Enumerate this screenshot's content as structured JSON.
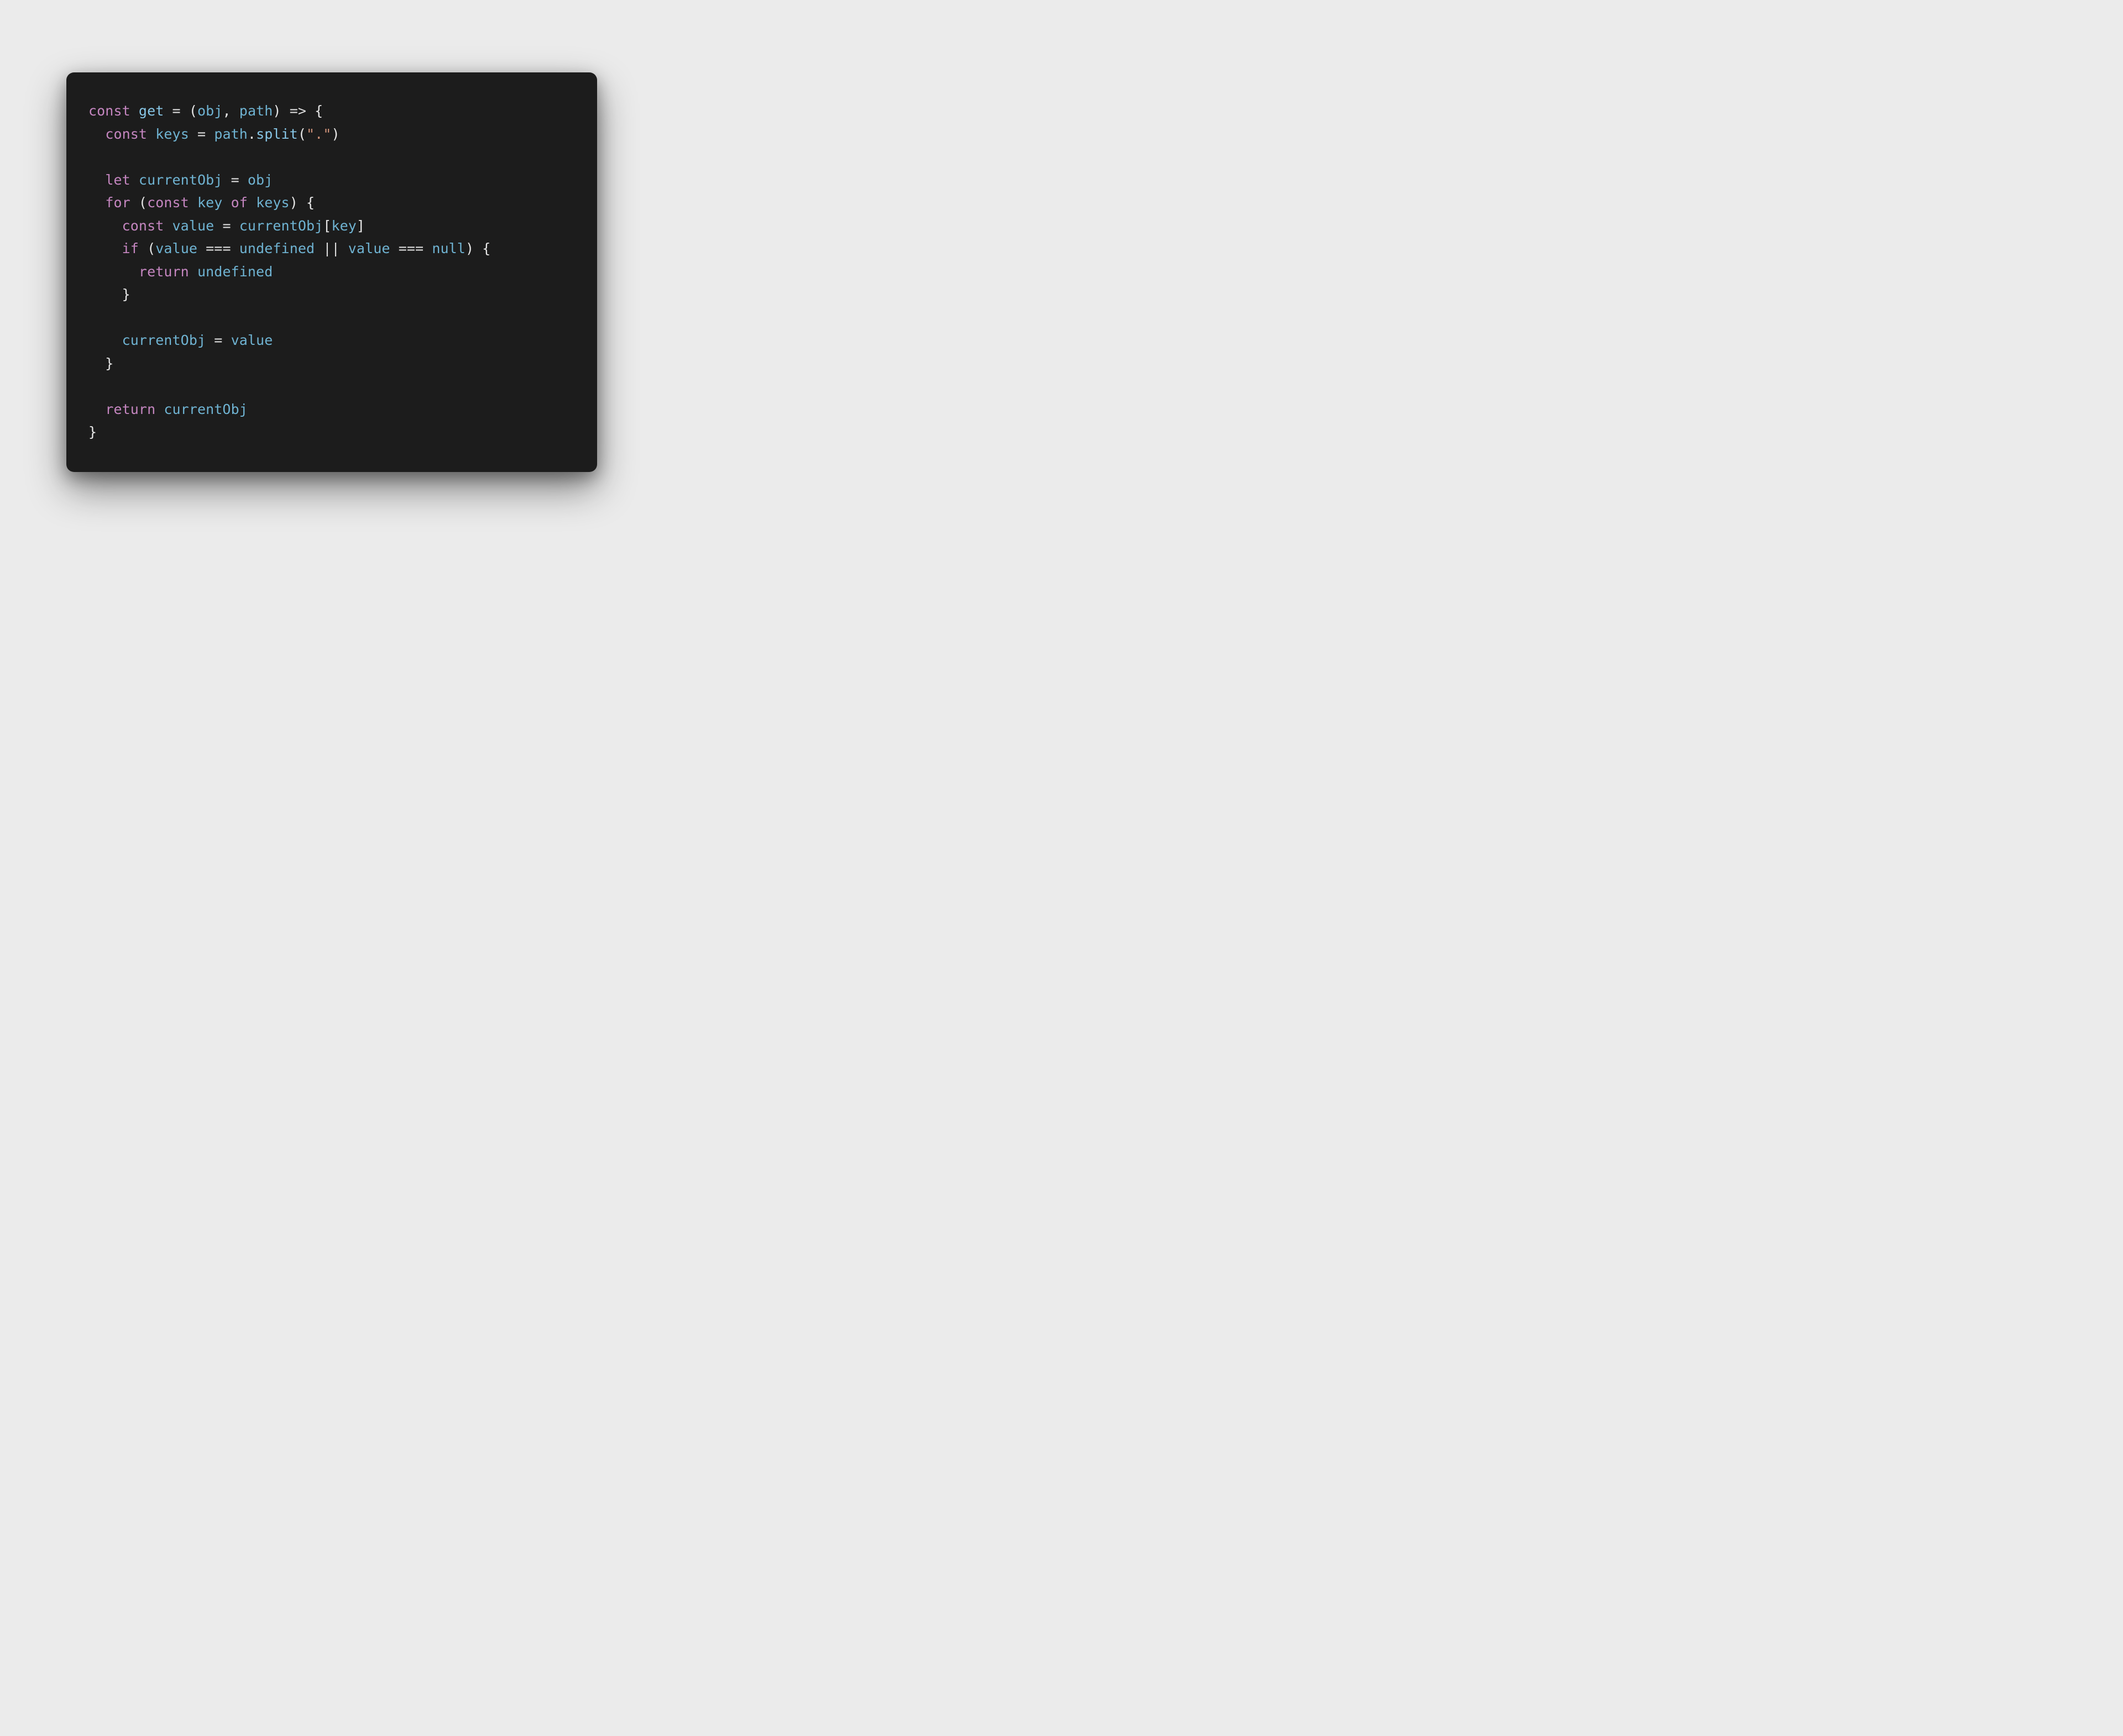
{
  "code": {
    "tokens": [
      [
        {
          "t": "const ",
          "c": "tok-kw"
        },
        {
          "t": "get",
          "c": "tok-fn"
        },
        {
          "t": " ",
          "c": "tok-pun"
        },
        {
          "t": "=",
          "c": "tok-op"
        },
        {
          "t": " (",
          "c": "tok-pun"
        },
        {
          "t": "obj",
          "c": "tok-var"
        },
        {
          "t": ", ",
          "c": "tok-pun"
        },
        {
          "t": "path",
          "c": "tok-var"
        },
        {
          "t": ") ",
          "c": "tok-pun"
        },
        {
          "t": "=>",
          "c": "tok-op"
        },
        {
          "t": " {",
          "c": "tok-pun"
        }
      ],
      [
        {
          "t": "  ",
          "c": "tok-pun"
        },
        {
          "t": "const ",
          "c": "tok-kw"
        },
        {
          "t": "keys",
          "c": "tok-var"
        },
        {
          "t": " ",
          "c": "tok-pun"
        },
        {
          "t": "=",
          "c": "tok-op"
        },
        {
          "t": " ",
          "c": "tok-pun"
        },
        {
          "t": "path",
          "c": "tok-var"
        },
        {
          "t": ".",
          "c": "tok-pun"
        },
        {
          "t": "split",
          "c": "tok-fn"
        },
        {
          "t": "(",
          "c": "tok-pun"
        },
        {
          "t": "\".\"",
          "c": "tok-str"
        },
        {
          "t": ")",
          "c": "tok-pun"
        }
      ],
      [
        {
          "t": " ",
          "c": "tok-pun"
        }
      ],
      [
        {
          "t": "  ",
          "c": "tok-pun"
        },
        {
          "t": "let ",
          "c": "tok-kw"
        },
        {
          "t": "currentObj",
          "c": "tok-var"
        },
        {
          "t": " ",
          "c": "tok-pun"
        },
        {
          "t": "=",
          "c": "tok-op"
        },
        {
          "t": " ",
          "c": "tok-pun"
        },
        {
          "t": "obj",
          "c": "tok-var"
        }
      ],
      [
        {
          "t": "  ",
          "c": "tok-pun"
        },
        {
          "t": "for ",
          "c": "tok-kw"
        },
        {
          "t": "(",
          "c": "tok-pun"
        },
        {
          "t": "const ",
          "c": "tok-kw"
        },
        {
          "t": "key",
          "c": "tok-var"
        },
        {
          "t": " ",
          "c": "tok-pun"
        },
        {
          "t": "of",
          "c": "tok-kw"
        },
        {
          "t": " ",
          "c": "tok-pun"
        },
        {
          "t": "keys",
          "c": "tok-var"
        },
        {
          "t": ") {",
          "c": "tok-pun"
        }
      ],
      [
        {
          "t": "    ",
          "c": "tok-pun"
        },
        {
          "t": "const ",
          "c": "tok-kw"
        },
        {
          "t": "value",
          "c": "tok-var"
        },
        {
          "t": " ",
          "c": "tok-pun"
        },
        {
          "t": "=",
          "c": "tok-op"
        },
        {
          "t": " ",
          "c": "tok-pun"
        },
        {
          "t": "currentObj",
          "c": "tok-var"
        },
        {
          "t": "[",
          "c": "tok-pun"
        },
        {
          "t": "key",
          "c": "tok-var"
        },
        {
          "t": "]",
          "c": "tok-pun"
        }
      ],
      [
        {
          "t": "    ",
          "c": "tok-pun"
        },
        {
          "t": "if ",
          "c": "tok-kw"
        },
        {
          "t": "(",
          "c": "tok-pun"
        },
        {
          "t": "value",
          "c": "tok-var"
        },
        {
          "t": " ",
          "c": "tok-pun"
        },
        {
          "t": "===",
          "c": "tok-op"
        },
        {
          "t": " ",
          "c": "tok-pun"
        },
        {
          "t": "undefined",
          "c": "tok-undf"
        },
        {
          "t": " ",
          "c": "tok-pun"
        },
        {
          "t": "||",
          "c": "tok-op"
        },
        {
          "t": " ",
          "c": "tok-pun"
        },
        {
          "t": "value",
          "c": "tok-var"
        },
        {
          "t": " ",
          "c": "tok-pun"
        },
        {
          "t": "===",
          "c": "tok-op"
        },
        {
          "t": " ",
          "c": "tok-pun"
        },
        {
          "t": "null",
          "c": "tok-undf"
        },
        {
          "t": ") {",
          "c": "tok-pun"
        }
      ],
      [
        {
          "t": "      ",
          "c": "tok-pun"
        },
        {
          "t": "return ",
          "c": "tok-kw"
        },
        {
          "t": "undefined",
          "c": "tok-undf"
        }
      ],
      [
        {
          "t": "    }",
          "c": "tok-pun"
        }
      ],
      [
        {
          "t": " ",
          "c": "tok-pun"
        }
      ],
      [
        {
          "t": "    ",
          "c": "tok-pun"
        },
        {
          "t": "currentObj",
          "c": "tok-var"
        },
        {
          "t": " ",
          "c": "tok-pun"
        },
        {
          "t": "=",
          "c": "tok-op"
        },
        {
          "t": " ",
          "c": "tok-pun"
        },
        {
          "t": "value",
          "c": "tok-var"
        }
      ],
      [
        {
          "t": "  }",
          "c": "tok-pun"
        }
      ],
      [
        {
          "t": " ",
          "c": "tok-pun"
        }
      ],
      [
        {
          "t": "  ",
          "c": "tok-pun"
        },
        {
          "t": "return ",
          "c": "tok-kw"
        },
        {
          "t": "currentObj",
          "c": "tok-var"
        }
      ],
      [
        {
          "t": "}",
          "c": "tok-pun"
        }
      ]
    ]
  }
}
